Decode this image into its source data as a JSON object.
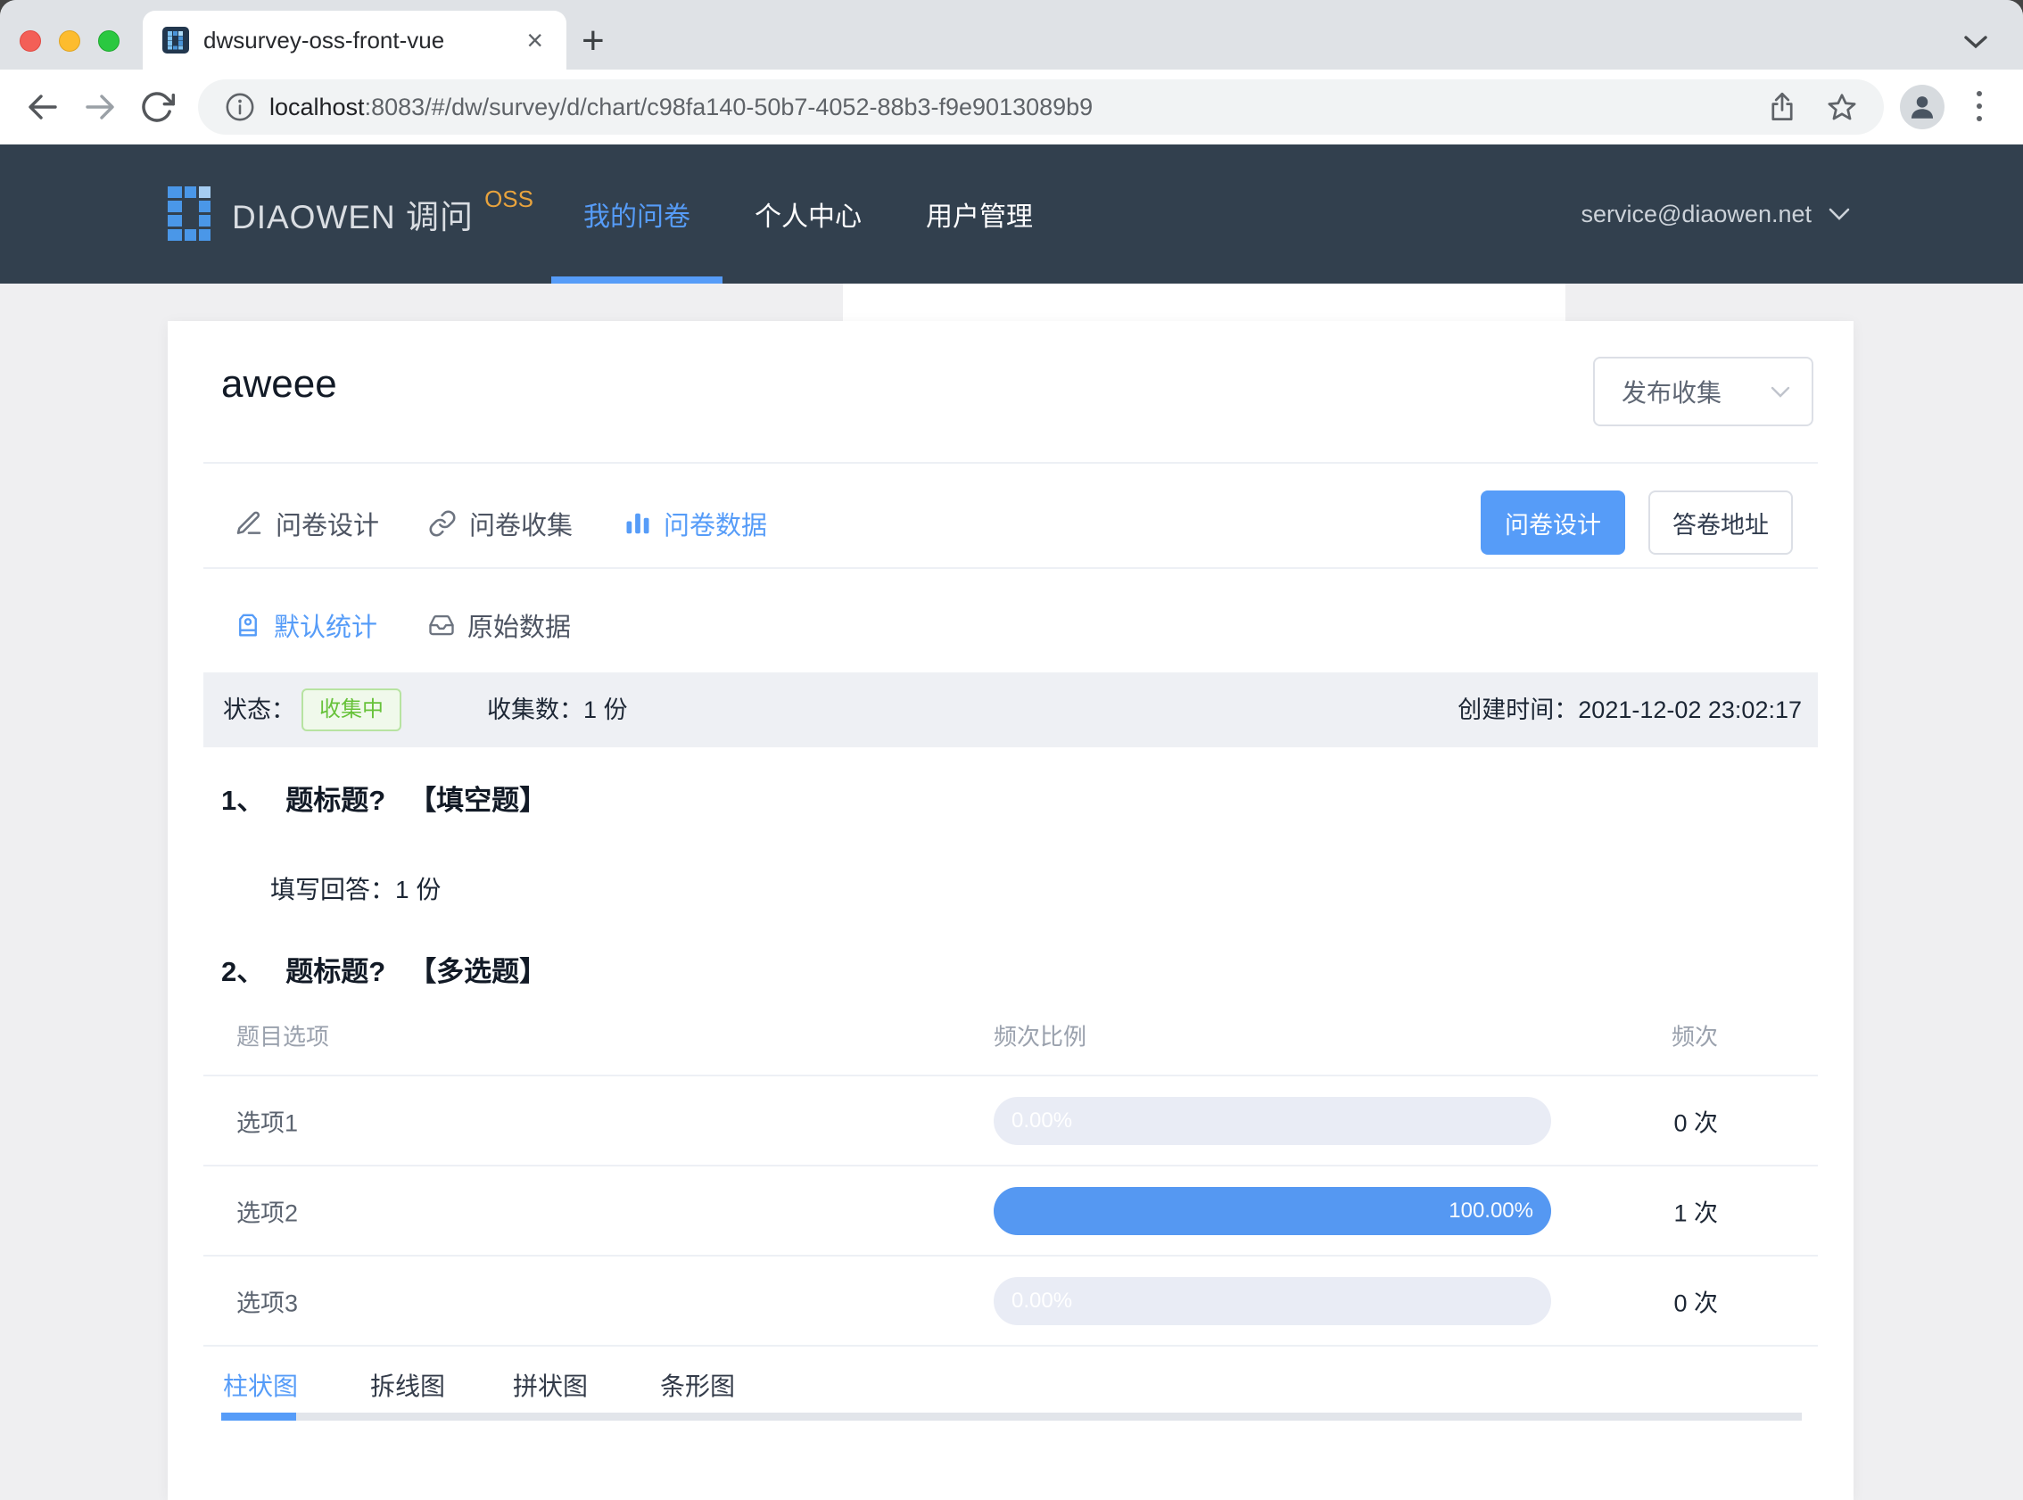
{
  "browser": {
    "tab_title": "dwsurvey-oss-front-vue",
    "url_host": "localhost",
    "url_rest": ":8083/#/dw/survey/d/chart/c98fa140-50b7-4052-88b3-f9e9013089b9",
    "close_glyph": "×",
    "new_tab_glyph": "+"
  },
  "header": {
    "brand": "DIAOWEN 调问",
    "brand_badge": "OSS",
    "nav": [
      {
        "label": "我的问卷"
      },
      {
        "label": "个人中心"
      },
      {
        "label": "用户管理"
      }
    ],
    "account": "service@diaowen.net"
  },
  "survey": {
    "title": "aweee",
    "publish_select": "发布收集",
    "section_tabs": [
      {
        "label": "问卷设计"
      },
      {
        "label": "问卷收集"
      },
      {
        "label": "问卷数据"
      }
    ],
    "design_button": "问卷设计",
    "answer_url_button": "答卷地址",
    "stat_tabs": [
      {
        "label": "默认统计"
      },
      {
        "label": "原始数据"
      }
    ],
    "status": {
      "label": "状态：",
      "badge": "收集中",
      "count_label": "收集数：",
      "count_value": "1 份",
      "created_label": "创建时间：",
      "created_value": "2021-12-02 23:02:17"
    }
  },
  "questions": [
    {
      "num": "1、",
      "title": "题标题?",
      "type": "【填空题】",
      "answer_label": "填写回答：",
      "answer_value": "1 份"
    },
    {
      "num": "2、",
      "title": "题标题?",
      "type": "【多选题】"
    }
  ],
  "table": {
    "headers": [
      "题目选项",
      "频次比例",
      "频次"
    ],
    "rows": [
      {
        "option": "选项1",
        "percent": "0.00%",
        "percent_value": 0,
        "count": "0 次"
      },
      {
        "option": "选项2",
        "percent": "100.00%",
        "percent_value": 100,
        "count": "1 次"
      },
      {
        "option": "选项3",
        "percent": "0.00%",
        "percent_value": 0,
        "count": "0 次"
      }
    ]
  },
  "chart_tabs": [
    {
      "label": "柱状图"
    },
    {
      "label": "拆线图"
    },
    {
      "label": "拼状图"
    },
    {
      "label": "条形图"
    }
  ],
  "colors": {
    "accent": "#569cf8",
    "bar-blue": "#5598f2",
    "bar-track": "#e9ecf5",
    "header-bg": "#32404e",
    "oss-orange": "#e8a33d",
    "badge-green": "#67c23a",
    "badge-green-bg": "#f0f9eb",
    "badge-green-border": "#b7e3a1"
  }
}
